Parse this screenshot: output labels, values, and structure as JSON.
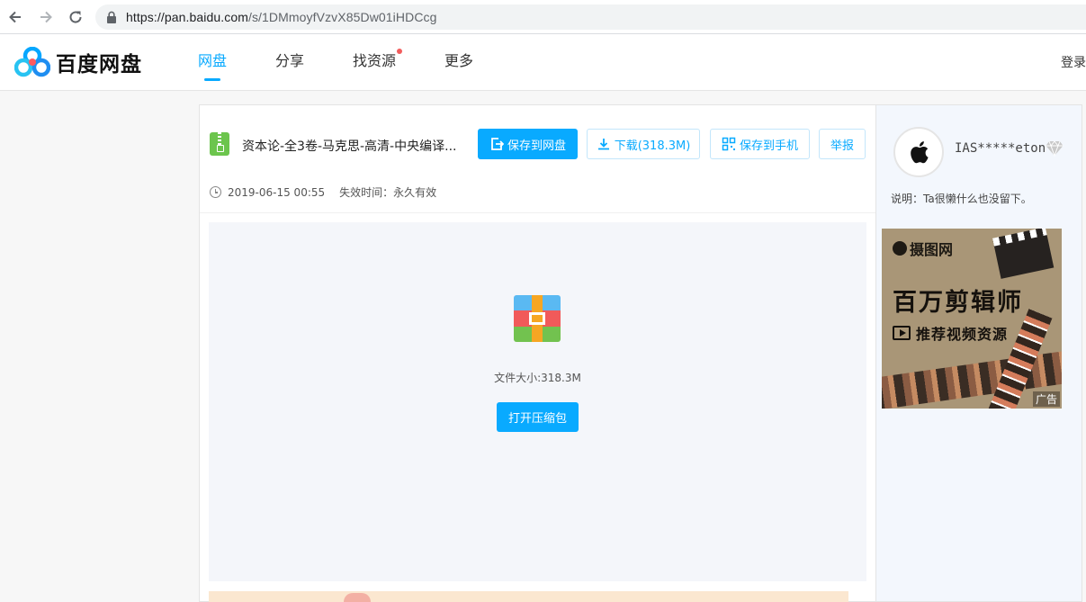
{
  "browser": {
    "url_host": "https://pan.baidu.com",
    "url_path": "/s/1DMmoyfVzvX85Dw01iHDCcg"
  },
  "header": {
    "logo_text": "百度网盘",
    "nav": [
      {
        "label": "网盘",
        "active": true
      },
      {
        "label": "分享",
        "active": false
      },
      {
        "label": "找资源",
        "active": false,
        "badge_dot": true
      },
      {
        "label": "更多",
        "active": false
      }
    ],
    "login_label": "登录"
  },
  "file": {
    "title": "资本论-全3卷-马克思-高清-中央编译...",
    "save_label": "保存到网盘",
    "download_label": "下载(318.3M)",
    "save_phone_label": "保存到手机",
    "report_label": "举报",
    "date": "2019-06-15 00:55",
    "expire": "失效时间：永久有效",
    "size_text": "文件大小:318.3M",
    "open_label": "打开压缩包"
  },
  "side": {
    "username": "IAS*****eton",
    "desc": "说明：Ta很懒什么也没留下。",
    "ad": {
      "brand": "摄图网",
      "headline": "百万剪辑师",
      "sub": "推荐视频资源",
      "tag": "广告"
    }
  },
  "colors": {
    "accent": "#09aaff",
    "badge": "#f25d5d",
    "zip_green": "#6cc54d"
  }
}
